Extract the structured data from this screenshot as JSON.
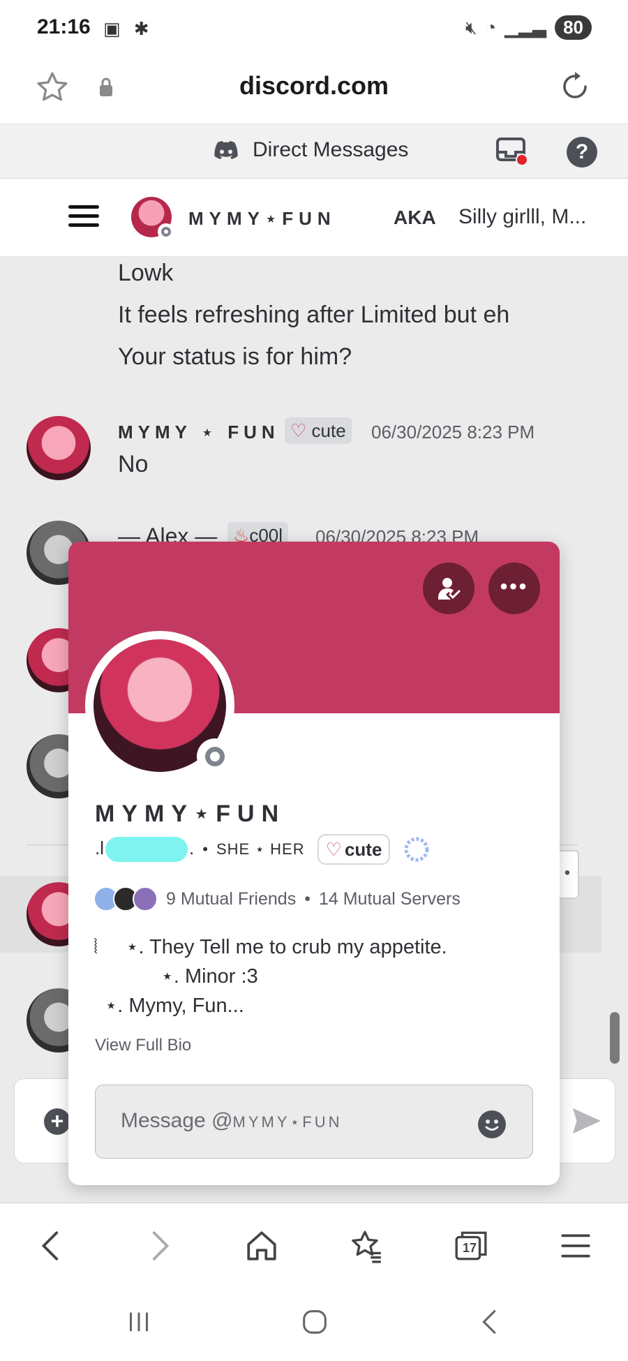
{
  "status_bar": {
    "time": "21:16",
    "battery": "80"
  },
  "browser": {
    "url": "discord.com"
  },
  "dm_bar": {
    "title": "Direct Messages"
  },
  "channel_header": {
    "name": "MYMY⋆FUN",
    "aka_label": "AKA",
    "aka_value": "Silly girlll, M..."
  },
  "messages": {
    "continued_lines": [
      "Lowk",
      "It feels refreshing after Limited but eh",
      "Your status is for him?"
    ],
    "msg1": {
      "author": "MYMY ⋆ FUN",
      "tag": "cute",
      "time": "06/30/2025 8:23 PM",
      "text": "No"
    },
    "msg2": {
      "author": "— Alex —",
      "tag": "c00l",
      "time": "06/30/2025 8:23 PM"
    }
  },
  "profile_popup": {
    "display_name": "MYMY⋆FUN",
    "handle_prefix": ".l",
    "handle_suffix": ".",
    "pronouns": "SHE ⋆ HER",
    "tag": "cute",
    "mutual_friends": "9 Mutual Friends",
    "mutual_servers": "14 Mutual Servers",
    "bio": [
      "⦚     ⋆. They Tell me to crub my appetite.",
      "            ⋆. Minor :3",
      "  ⋆. Mymy, Fun..."
    ],
    "view_full_bio": "View Full Bio",
    "message_placeholder_prefix": "Message @",
    "message_placeholder_name": "MYMY⋆FUN"
  },
  "bottom_nav": {
    "tabs_count": "17"
  },
  "colors": {
    "banner": "#c23a62",
    "banner_button": "#6d1f33",
    "redaction": "#7ff3f0"
  }
}
